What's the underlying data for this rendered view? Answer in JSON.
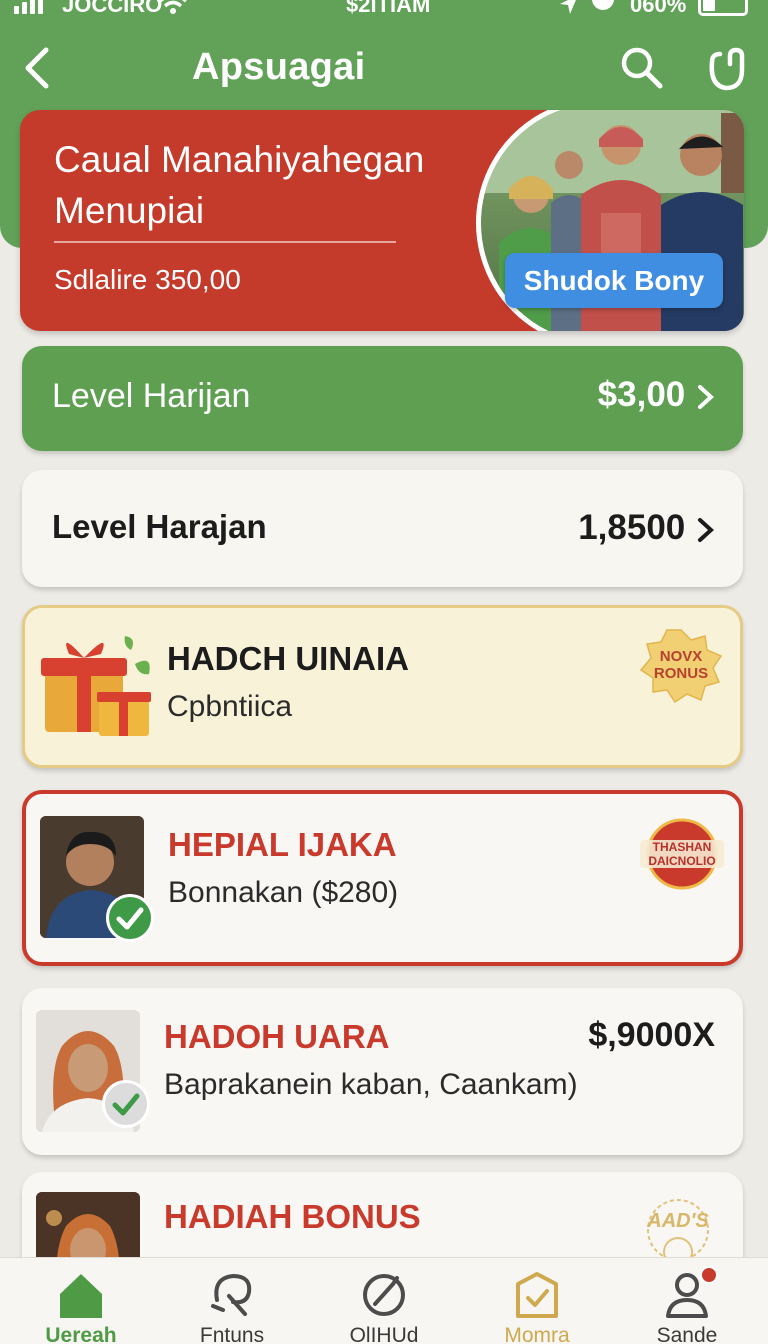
{
  "status_bar": {
    "carrier": "JOCCIRO",
    "time": "$2ITIAM",
    "battery_text": "060%"
  },
  "header": {
    "title": "Apsuagai"
  },
  "banner": {
    "title": "Caual Manahiyahegan Menupiai",
    "amount_text": "Sdlalire 350,00",
    "button_label": "Shudok Bony"
  },
  "levels": [
    {
      "label": "Level Harijan",
      "value": "$3,00"
    },
    {
      "label": "Level Harajan",
      "value": "1,8500"
    }
  ],
  "cards": [
    {
      "title": "HADCH UINAIA",
      "subtitle": "Cpbntiica",
      "sticker_text": "NOVX RONUS"
    },
    {
      "title": "HEPIAL IJAKA",
      "subtitle": "Bonnakan ($280)",
      "sticker_text": "THASHAN DAICNOLIO"
    },
    {
      "title": "HADOH UARA",
      "subtitle": "Baprakanein kaban, Caankam)",
      "amount": "$,9000X"
    },
    {
      "title": "HADIAH BONUS",
      "sticker_text": "AAD'S"
    }
  ],
  "bottom_nav": [
    {
      "label": "Uereah",
      "icon": "home-icon"
    },
    {
      "label": "Fntuns",
      "icon": "hook-icon"
    },
    {
      "label": "OlIHUd",
      "icon": "compass-icon"
    },
    {
      "label": "Momra",
      "icon": "task-icon"
    },
    {
      "label": "Sande",
      "icon": "person-icon"
    }
  ],
  "colors": {
    "primary_green": "#62a158",
    "accent_red": "#c43b2c",
    "button_blue": "#3f8ee1",
    "gift_card_bg": "#f8f2d8",
    "gold": "#d0a94f"
  }
}
